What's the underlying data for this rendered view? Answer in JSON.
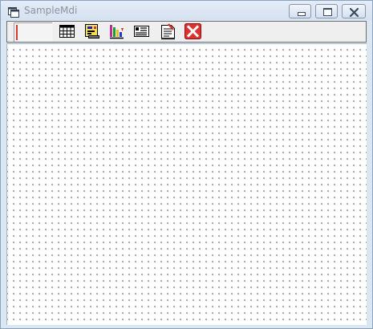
{
  "window": {
    "title": "SampleMdi",
    "caption_buttons": [
      "minimize",
      "restore",
      "close"
    ]
  },
  "toolbar": {
    "edit_value": "",
    "buttons": [
      {
        "icon": "grid-icon"
      },
      {
        "icon": "form-layout-icon"
      },
      {
        "icon": "chart-icon"
      },
      {
        "icon": "card-view-icon"
      },
      {
        "icon": "report-icon"
      },
      {
        "icon": "exit-icon"
      }
    ]
  },
  "colors": {
    "titlebar": "#dbe6f3",
    "close_red": "#e03131",
    "grid_dot": "#606060"
  }
}
